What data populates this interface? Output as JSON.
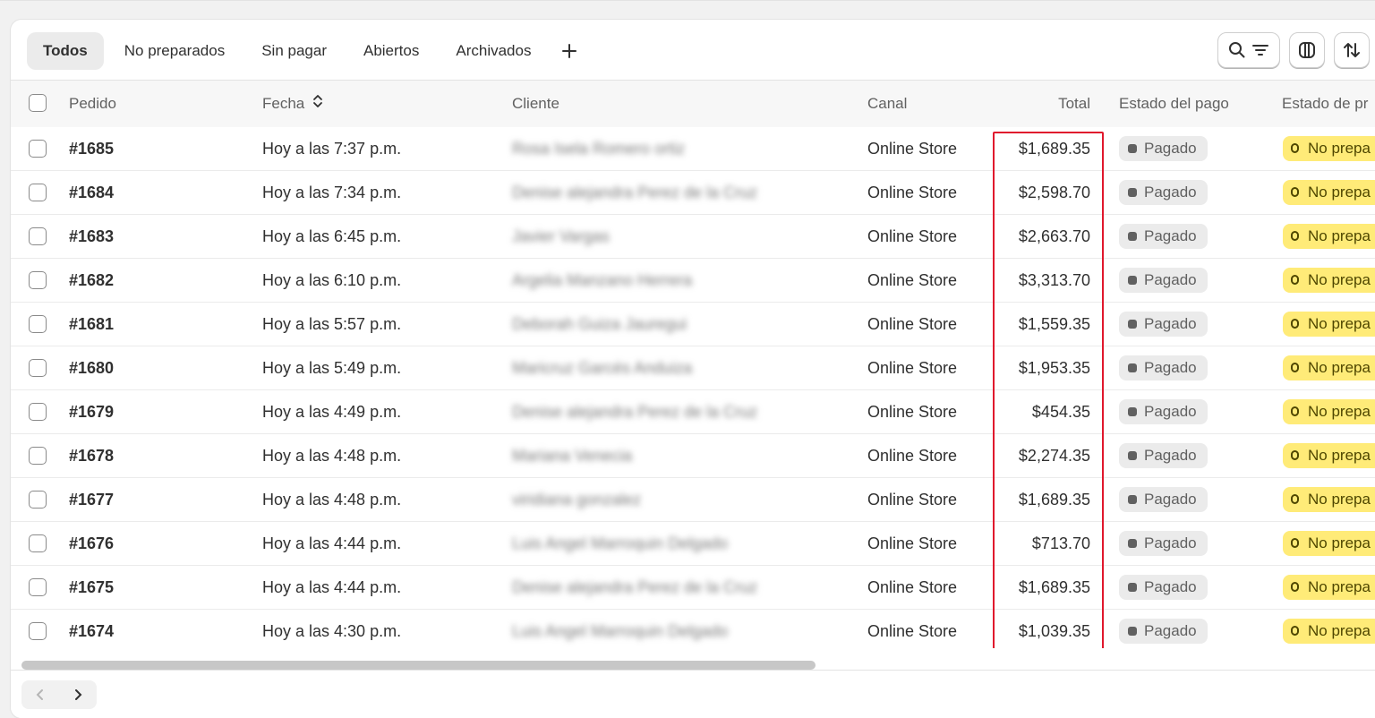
{
  "tabs": [
    {
      "label": "Todos",
      "active": true
    },
    {
      "label": "No preparados",
      "active": false
    },
    {
      "label": "Sin pagar",
      "active": false
    },
    {
      "label": "Abiertos",
      "active": false
    },
    {
      "label": "Archivados",
      "active": false
    }
  ],
  "add_tab_icon": "plus-icon",
  "toolbar_icons": [
    "search-icon",
    "filter-icon",
    "columns-icon",
    "sort-icon"
  ],
  "columns": {
    "order": "Pedido",
    "date": "Fecha",
    "customer": "Cliente",
    "channel": "Canal",
    "total": "Total",
    "payment_status": "Estado del pago",
    "fulfillment_status": "Estado de pr"
  },
  "orders": [
    {
      "id": "#1685",
      "date": "Hoy a las 7:37 p.m.",
      "customer": "Rosa Isela Romero ortiz",
      "channel": "Online Store",
      "total": "$1,689.35",
      "payment": "Pagado",
      "fulfillment": "No prepa"
    },
    {
      "id": "#1684",
      "date": "Hoy a las 7:34 p.m.",
      "customer": "Denise alejandra Perez de la Cruz",
      "channel": "Online Store",
      "total": "$2,598.70",
      "payment": "Pagado",
      "fulfillment": "No prepa"
    },
    {
      "id": "#1683",
      "date": "Hoy a las 6:45 p.m.",
      "customer": "Javier Vargas",
      "channel": "Online Store",
      "total": "$2,663.70",
      "payment": "Pagado",
      "fulfillment": "No prepa"
    },
    {
      "id": "#1682",
      "date": "Hoy a las 6:10 p.m.",
      "customer": "Argelia Manzano Herrera",
      "channel": "Online Store",
      "total": "$3,313.70",
      "payment": "Pagado",
      "fulfillment": "No prepa"
    },
    {
      "id": "#1681",
      "date": "Hoy a las 5:57 p.m.",
      "customer": "Deborah Guiza Jauregui",
      "channel": "Online Store",
      "total": "$1,559.35",
      "payment": "Pagado",
      "fulfillment": "No prepa"
    },
    {
      "id": "#1680",
      "date": "Hoy a las 5:49 p.m.",
      "customer": "Maricruz Garcés Anduiza",
      "channel": "Online Store",
      "total": "$1,953.35",
      "payment": "Pagado",
      "fulfillment": "No prepa"
    },
    {
      "id": "#1679",
      "date": "Hoy a las 4:49 p.m.",
      "customer": "Denise alejandra Perez de la Cruz",
      "channel": "Online Store",
      "total": "$454.35",
      "payment": "Pagado",
      "fulfillment": "No prepa"
    },
    {
      "id": "#1678",
      "date": "Hoy a las 4:48 p.m.",
      "customer": "Mariana Venecia",
      "channel": "Online Store",
      "total": "$2,274.35",
      "payment": "Pagado",
      "fulfillment": "No prepa"
    },
    {
      "id": "#1677",
      "date": "Hoy a las 4:48 p.m.",
      "customer": "viridiana gonzalez",
      "channel": "Online Store",
      "total": "$1,689.35",
      "payment": "Pagado",
      "fulfillment": "No prepa"
    },
    {
      "id": "#1676",
      "date": "Hoy a las 4:44 p.m.",
      "customer": "Luis Angel Marroquin Delgado",
      "channel": "Online Store",
      "total": "$713.70",
      "payment": "Pagado",
      "fulfillment": "No prepa"
    },
    {
      "id": "#1675",
      "date": "Hoy a las 4:44 p.m.",
      "customer": "Denise alejandra Perez de la Cruz",
      "channel": "Online Store",
      "total": "$1,689.35",
      "payment": "Pagado",
      "fulfillment": "No prepa"
    },
    {
      "id": "#1674",
      "date": "Hoy a las 4:30 p.m.",
      "customer": "Luis Angel Marroquin Delgado",
      "channel": "Online Store",
      "total": "$1,039.35",
      "payment": "Pagado",
      "fulfillment": "No prepa"
    }
  ],
  "colors": {
    "highlight": "#e0182d",
    "paid_badge_bg": "#ebebeb",
    "unfulfilled_badge_bg": "#ffeb78"
  }
}
